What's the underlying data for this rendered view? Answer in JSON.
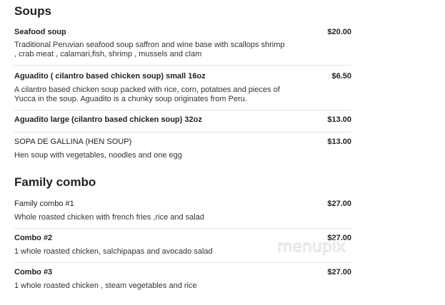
{
  "sections": [
    {
      "title": "Soups",
      "items": [
        {
          "name": "Seafood soup",
          "price": "$20.00",
          "description": "Traditional Peruvian seafood soup saffron and wine base with scallops shrimp , crab meat , calamari,fish, shrimp , mussels and clam"
        },
        {
          "name": "Aguadito ( cilantro based chicken soup) small 16oz",
          "price": "$6.50",
          "description": "A cilantro based chicken soup packed with rice, corn, potatoes and pieces of Yucca in the soup. Aguadito is a chunky soup originates from Peru."
        },
        {
          "name": "Aguadito large (cilantro based chicken soup) 32oz",
          "price": "$13.00",
          "description": ""
        },
        {
          "name": "SOPA DE GALLINA (HEN SOUP)",
          "price": "$13.00",
          "description": "Hen soup with vegetables, noodles and one egg"
        }
      ]
    },
    {
      "title": "Family combo",
      "items": [
        {
          "name": "Family combo #1",
          "price": "$27.00",
          "description": "Whole roasted chicken with french fries ,rice and salad"
        },
        {
          "name": "Combo #2",
          "price": "$27.00",
          "description": "1 whole roasted chicken, salchipapas and avocado salad"
        },
        {
          "name": "Combo #3",
          "price": "$27.00",
          "description": "1 whole roasted chicken , steam vegetables and rice"
        }
      ]
    }
  ],
  "watermark": "menupix"
}
